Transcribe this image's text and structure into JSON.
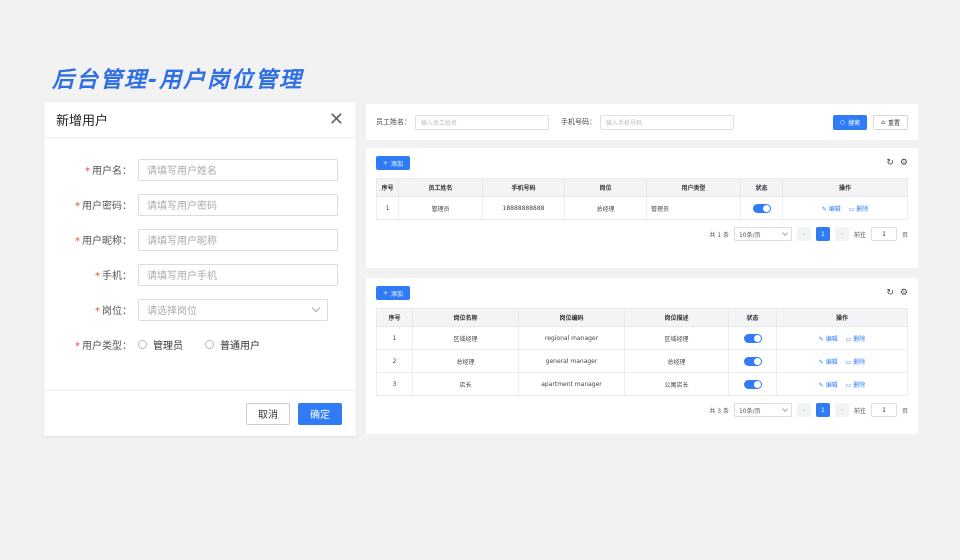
{
  "page_title": "后台管理-用户岗位管理",
  "dialog": {
    "title": "新增用户",
    "close": "✕",
    "fields": [
      {
        "label": "用户名：",
        "placeholder": "请填写用户姓名"
      },
      {
        "label": "用户密码：",
        "placeholder": "请填写用户密码"
      },
      {
        "label": "用户昵称：",
        "placeholder": "请填写用户昵称"
      },
      {
        "label": "手机：",
        "placeholder": "请填写用户手机"
      }
    ],
    "post_label": "岗位：",
    "post_placeholder": "请选择岗位",
    "type_label": "用户类型：",
    "type_options": [
      "管理员",
      "普通用户"
    ],
    "required_mark": "*",
    "cancel": "取消",
    "confirm": "确定"
  },
  "search": {
    "name_label": "员工姓名：",
    "name_placeholder": "输入员工姓名",
    "phone_label": "手机号码：",
    "phone_placeholder": "输入手机号码",
    "search_btn": "搜索",
    "reset_btn": "重置"
  },
  "user_table": {
    "add": "添加",
    "headers": [
      "序号",
      "员工姓名",
      "手机号码",
      "岗位",
      "用户类型",
      "状态",
      "操作"
    ],
    "rows": [
      {
        "no": "1",
        "name": "管理员",
        "phone": "18888888888",
        "post": "总经理",
        "type": "管理员"
      }
    ],
    "edit": "编辑",
    "delete": "删除",
    "pager": {
      "total": "共 1 条",
      "size": "10条/页",
      "page": "1",
      "goto": "前往",
      "goto_val": "1",
      "unit": "页"
    }
  },
  "post_table": {
    "add": "添加",
    "headers": [
      "序号",
      "岗位名称",
      "岗位编码",
      "岗位描述",
      "状态",
      "操作"
    ],
    "rows": [
      {
        "no": "1",
        "name": "区域经理",
        "code": "regional manager",
        "desc": "区域经理"
      },
      {
        "no": "2",
        "name": "总经理",
        "code": "general manager",
        "desc": "总经理"
      },
      {
        "no": "3",
        "name": "店长",
        "code": "apartment manager",
        "desc": "公寓店长"
      }
    ],
    "edit": "编辑",
    "delete": "删除",
    "pager": {
      "total": "共 3 条",
      "size": "10条/页",
      "page": "1",
      "goto": "前往",
      "goto_val": "1",
      "unit": "页"
    }
  },
  "colors": {
    "accent": "#2f7cf6",
    "title": "#2f6fe4",
    "required": "#e74c3c"
  }
}
